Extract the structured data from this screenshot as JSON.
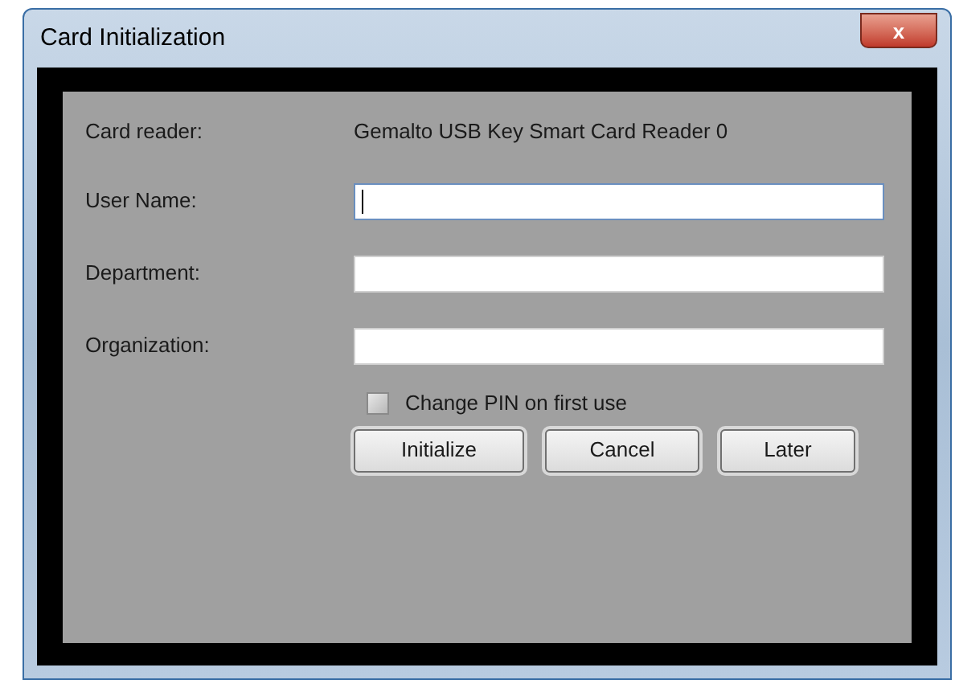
{
  "window": {
    "title": "Card Initialization",
    "close_label": "x"
  },
  "card_reader": {
    "label": "Card reader:",
    "value": "Gemalto USB Key Smart Card Reader 0"
  },
  "fields": [
    {
      "label": "User Name:",
      "focused": true
    },
    {
      "label": "Department:",
      "focused": false
    },
    {
      "label": "Organization:",
      "focused": false
    }
  ],
  "checkbox": {
    "label": "Change PIN on first use",
    "checked": false
  },
  "buttons": [
    "Initialize",
    "Cancel",
    "Later"
  ]
}
